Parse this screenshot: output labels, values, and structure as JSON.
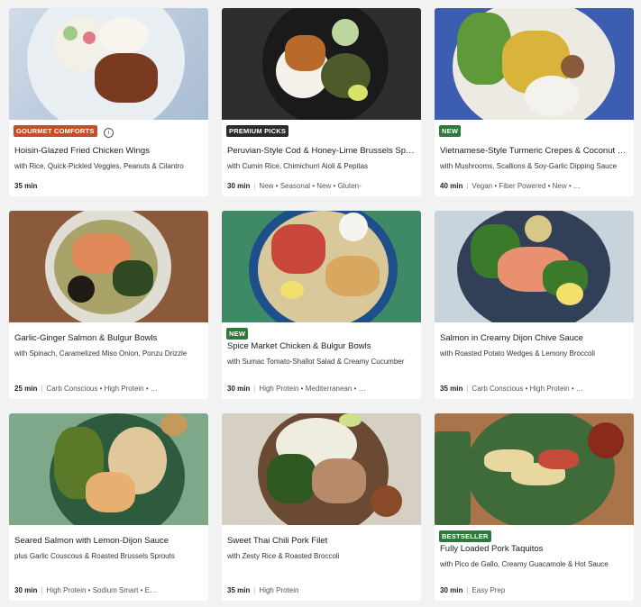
{
  "cards": [
    {
      "badge": "GOURMET COMFORTS",
      "badge_color": "#c0502a",
      "title": "Hoisin-Glazed Fried Chicken Wings",
      "subtitle": "with Rice, Quick-Pickled Veggies, Peanuts & Cilantro",
      "time": "35 min",
      "tags": []
    },
    {
      "badge": "PREMIUM PICKS",
      "badge_color": "#2b2b2b",
      "title": "Peruvian-Style Cod & Honey-Lime Brussels Sprouts",
      "subtitle": "with Cumin Rice, Chimichurri Aioli & Pepitas",
      "time": "30 min",
      "tags": [
        "New",
        "Seasonal",
        "New",
        "Gluten-"
      ]
    },
    {
      "badge": "NEW",
      "badge_color": "#2e7a3a",
      "title": "Vietnamese-Style Turmeric Crepes & Coconut Rice",
      "subtitle": "with Mushrooms, Scallions & Soy-Garlic Dipping Sauce",
      "time": "40 min",
      "tags": [
        "Vegan",
        "Fiber Powered",
        "New",
        "…"
      ]
    },
    {
      "badge": "",
      "badge_color": "",
      "title": "Garlic-Ginger Salmon & Bulgur Bowls",
      "subtitle": "with Spinach, Caramelized Miso Onion, Ponzu Drizzle",
      "time": "25 min",
      "tags": [
        "Carb Conscious",
        "High Protein",
        "…"
      ]
    },
    {
      "badge": "NEW",
      "badge_color": "#2e7a3a",
      "title": "Spice Market Chicken & Bulgur Bowls",
      "subtitle": "with Sumac Tomato-Shallot Salad & Creamy Cucumber",
      "time": "30 min",
      "tags": [
        "High Protein",
        "Mediterranean",
        "…"
      ]
    },
    {
      "badge": "",
      "badge_color": "",
      "title": "Salmon in Creamy Dijon Chive Sauce",
      "subtitle": "with Roasted Potato Wedges & Lemony Broccoli",
      "time": "35 min",
      "tags": [
        "Carb Conscious",
        "High Protein",
        "…"
      ]
    },
    {
      "badge": "",
      "badge_color": "",
      "title": "Seared Salmon with Lemon-Dijon Sauce",
      "subtitle": "plus Garlic Couscous & Roasted Brussels Sprouts",
      "time": "30 min",
      "tags": [
        "High Protein",
        "Sodium Smart",
        "E…"
      ]
    },
    {
      "badge": "",
      "badge_color": "",
      "title": "Sweet Thai Chili Pork Filet",
      "subtitle": "with Zesty Rice & Roasted Broccoli",
      "time": "35 min",
      "tags": [
        "High Protein"
      ]
    },
    {
      "badge": "BESTSELLER",
      "badge_color": "#2e7a3a",
      "title": "Fully Loaded Pork Taquitos",
      "subtitle": "with Pico de Gallo, Creamy Guacamole & Hot Sauce",
      "time": "30 min",
      "tags": [
        "Easy Prep"
      ]
    }
  ]
}
